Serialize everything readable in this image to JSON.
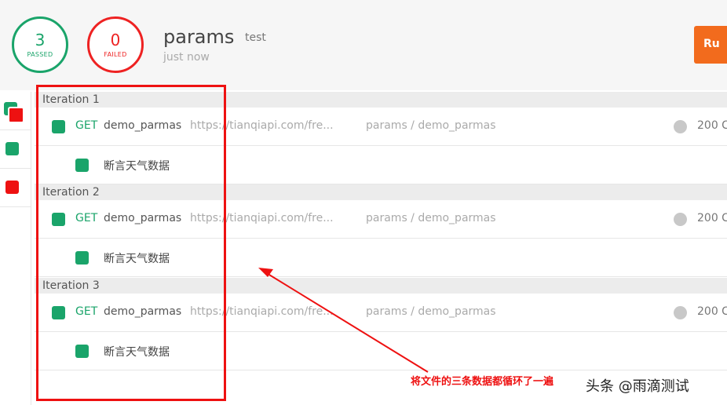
{
  "summary": {
    "passed_count": "3",
    "passed_label": "PASSED",
    "failed_count": "0",
    "failed_label": "FAILED",
    "run_name": "params",
    "environment": "test",
    "time_ago": "just now",
    "run_button_label": "Ru"
  },
  "iterations": [
    {
      "label": "Iteration 1",
      "request": {
        "method": "GET",
        "name": "demo_parmas",
        "url": "https://tianqiapi.com/fre...",
        "path": "params / demo_parmas",
        "status": "200 C"
      },
      "assertion": "断言天气数据"
    },
    {
      "label": "Iteration 2",
      "request": {
        "method": "GET",
        "name": "demo_parmas",
        "url": "https://tianqiapi.com/fre...",
        "path": "params / demo_parmas",
        "status": "200 C"
      },
      "assertion": "断言天气数据"
    },
    {
      "label": "Iteration 3",
      "request": {
        "method": "GET",
        "name": "demo_parmas",
        "url": "https://tianqiapi.com/fre...",
        "path": "params / demo_parmas",
        "status": "200 C"
      },
      "assertion": "断言天气数据"
    }
  ],
  "annotation": "将文件的三条数据都循环了一遍",
  "watermark": "头条 @雨滴测试",
  "colors": {
    "pass": "#1aa46a",
    "fail": "#ee2222",
    "run_button": "#f26b1d",
    "annotation": "#ee1111"
  }
}
